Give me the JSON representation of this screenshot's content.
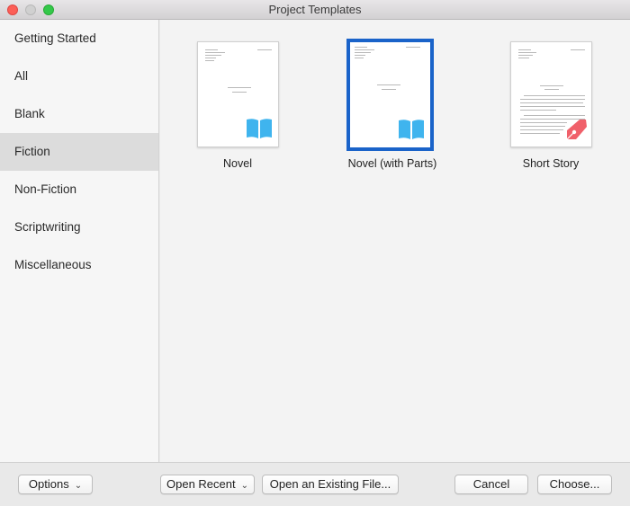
{
  "window": {
    "title": "Project Templates"
  },
  "sidebar": {
    "items": [
      {
        "label": "Getting Started"
      },
      {
        "label": "All"
      },
      {
        "label": "Blank"
      },
      {
        "label": "Fiction",
        "selected": true
      },
      {
        "label": "Non-Fiction"
      },
      {
        "label": "Scriptwriting"
      },
      {
        "label": "Miscellaneous"
      }
    ]
  },
  "templates": [
    {
      "label": "Novel",
      "icon": "book-icon"
    },
    {
      "label": "Novel (with Parts)",
      "icon": "book-icon",
      "selected": true
    },
    {
      "label": "Short Story",
      "icon": "fountain-pen-icon"
    }
  ],
  "footer": {
    "options_label": "Options",
    "open_recent_label": "Open Recent",
    "open_existing_label": "Open an Existing File...",
    "cancel_label": "Cancel",
    "choose_label": "Choose..."
  },
  "colors": {
    "selection_border": "#1a63c9",
    "book_icon": "#3fb4ee",
    "pen_icon": "#f0606a"
  }
}
